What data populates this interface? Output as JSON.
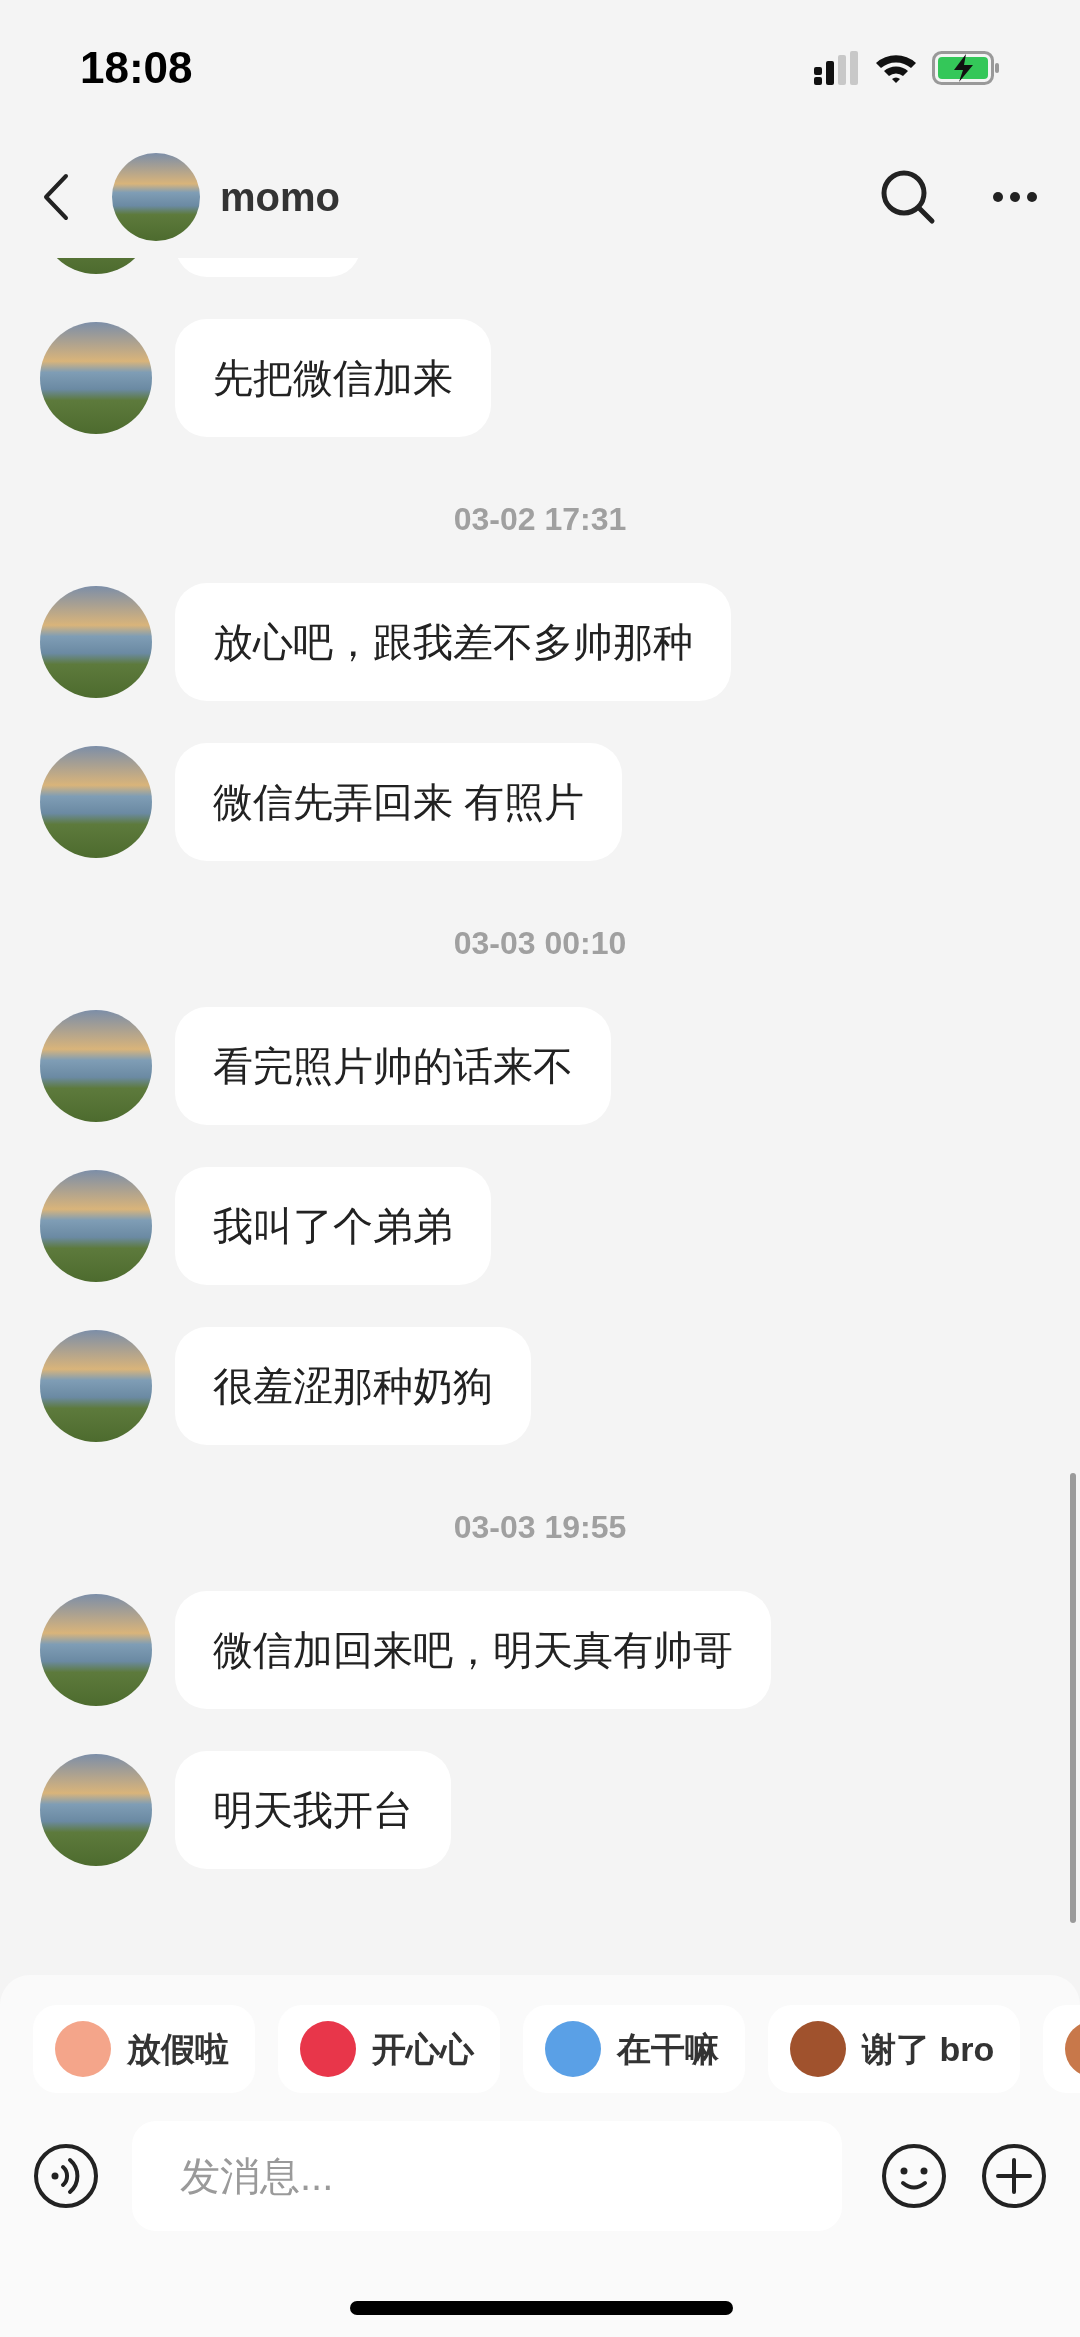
{
  "status_bar": {
    "time": "18:08"
  },
  "header": {
    "name": "momo"
  },
  "messages": [
    {
      "kind": "clipped"
    },
    {
      "kind": "message",
      "text": "先把微信加来"
    },
    {
      "kind": "timestamp",
      "text": "03-02 17:31"
    },
    {
      "kind": "message",
      "text": "放心吧，跟我差不多帅那种"
    },
    {
      "kind": "message",
      "text": "微信先弄回来 有照片"
    },
    {
      "kind": "timestamp",
      "text": "03-03 00:10"
    },
    {
      "kind": "message",
      "text": "看完照片帅的话来不"
    },
    {
      "kind": "message",
      "text": "我叫了个弟弟"
    },
    {
      "kind": "message",
      "text": "很羞涩那种奶狗"
    },
    {
      "kind": "timestamp",
      "text": "03-03 19:55"
    },
    {
      "kind": "message",
      "text": "微信加回来吧，明天真有帅哥"
    },
    {
      "kind": "message",
      "text": "明天我开台"
    }
  ],
  "stickers": [
    {
      "label": "放假啦",
      "color": "#f4a58a"
    },
    {
      "label": "开心心",
      "color": "#e8364a"
    },
    {
      "label": "在干嘛",
      "color": "#5aa0e6"
    },
    {
      "label": "谢了 bro",
      "color": "#a0522d"
    },
    {
      "color": "#c8784a"
    }
  ],
  "composer": {
    "placeholder": "发消息..."
  }
}
